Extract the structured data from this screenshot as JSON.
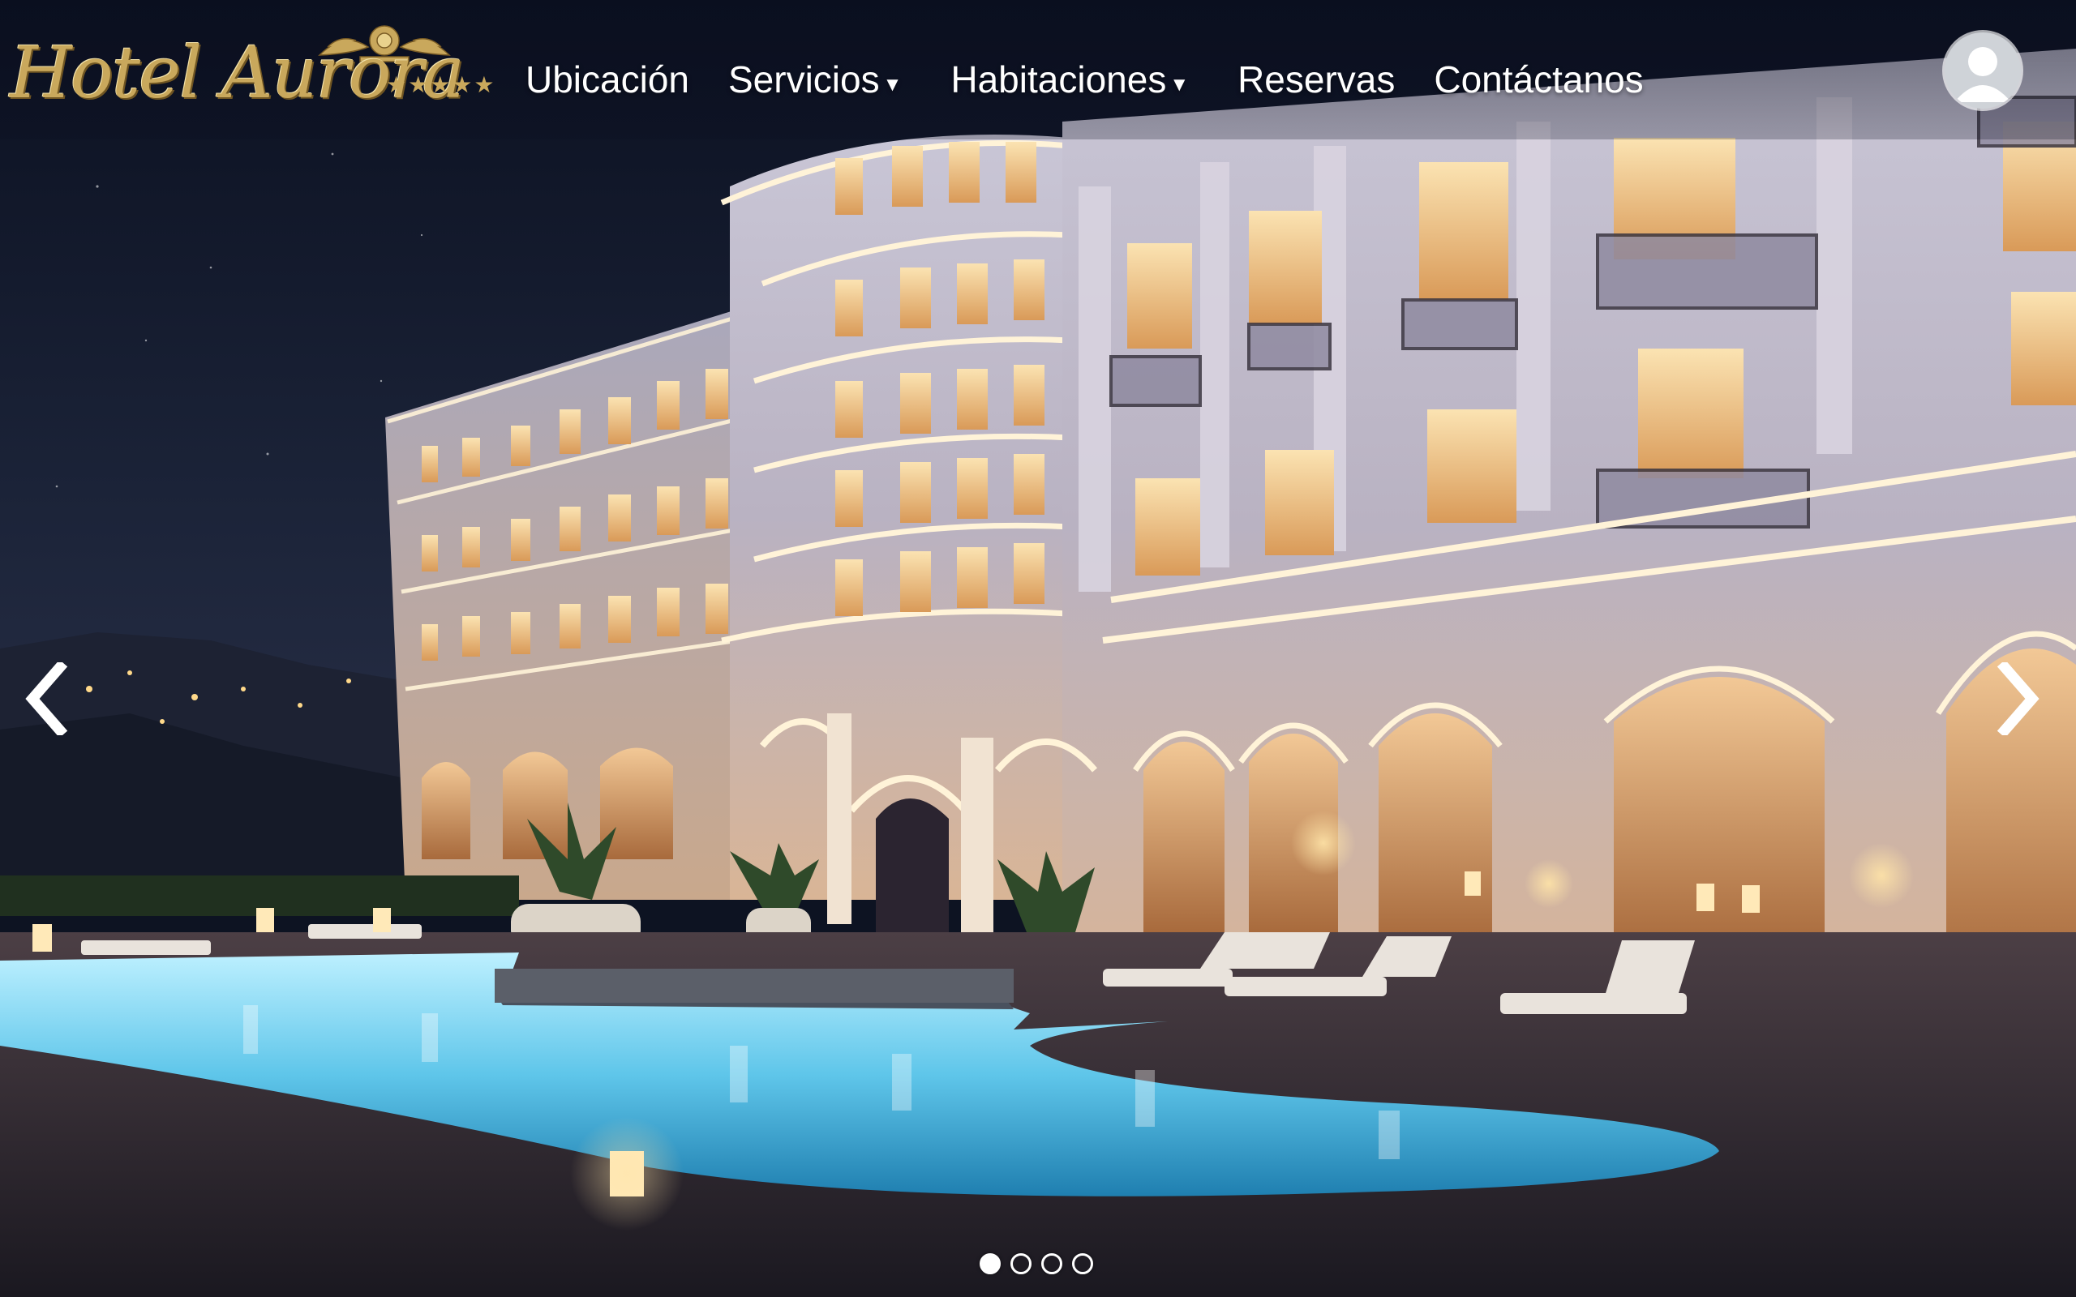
{
  "brand": {
    "name": "Hotel Aurora",
    "stars": "★★★★★"
  },
  "nav": {
    "items": [
      {
        "label": "Ubicación",
        "caret": ""
      },
      {
        "label": "Servicios",
        "caret": "▼"
      },
      {
        "label": "Habitaciones",
        "caret": "▼"
      },
      {
        "label": "Reservas",
        "caret": ""
      },
      {
        "label": "Contáctanos",
        "caret": ""
      }
    ]
  },
  "user": {
    "icon": "user-avatar-icon"
  },
  "carousel": {
    "prev_icon": "chevron-left-icon",
    "next_icon": "chevron-right-icon",
    "slide_count": 4,
    "active_slide": 1
  },
  "colors": {
    "brand_gold": "#c9a85c",
    "nav_text": "#ffffff",
    "pool": "#5fc6ea"
  }
}
